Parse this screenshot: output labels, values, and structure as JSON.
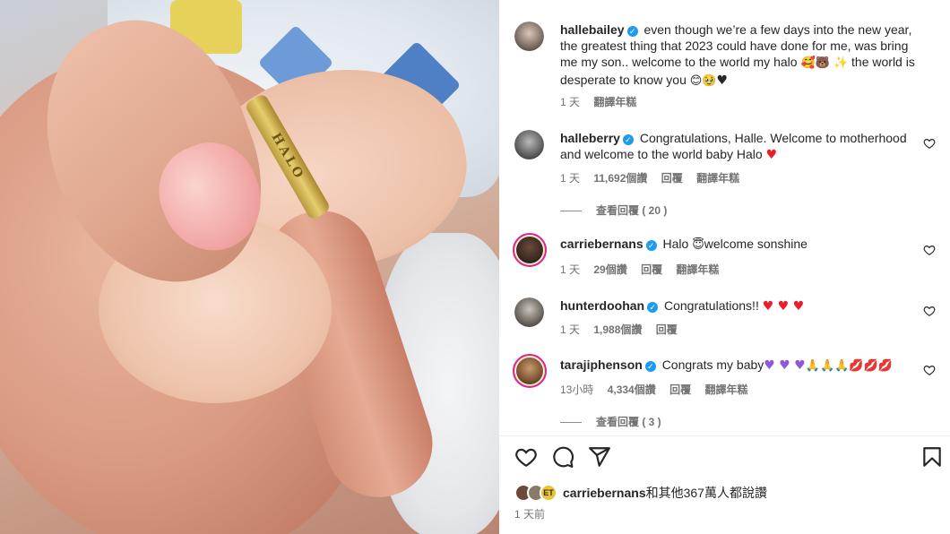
{
  "photo": {
    "bracelet_text": "HALO"
  },
  "caption": {
    "username": "hallebailey",
    "text": "even though we’re a few days into the new year, the greatest thing that 2023 could have done for me, was bring me my son.. welcome to the world my halo",
    "text_end_a": "the world is desperate to know you",
    "time": "1 天",
    "translate": "翻譯年糕"
  },
  "comments": [
    {
      "username": "halleberry",
      "text": "Congratulations, Halle. Welcome to motherhood and welcome to the world baby Halo",
      "time": "1 天",
      "likes": "11,692個讚",
      "reply": "回覆",
      "translate": "翻譯年糕",
      "view_replies": "查看回覆 ( 20 )"
    },
    {
      "username": "carriebernans",
      "text_a": "Halo",
      "text_b": "welcome sonshine",
      "time": "1 天",
      "likes": "29個讚",
      "reply": "回覆",
      "translate": "翻譯年糕"
    },
    {
      "username": "hunterdoohan",
      "text": "Congratulations!!",
      "time": "1 天",
      "likes": "1,988個讚",
      "reply": "回覆"
    },
    {
      "username": "tarajiphenson",
      "text": "Congrats my baby",
      "time": "13小時",
      "likes": "4,334個讚",
      "reply": "回覆",
      "translate": "翻譯年糕",
      "view_replies": "查看回覆 ( 3 )"
    }
  ],
  "likes_bar": {
    "et_badge": "ET",
    "username": "carriebernans",
    "rest": "和其他367萬人都說讚"
  },
  "post_time": "1 天前",
  "icons": [
    "verified-badge",
    "heart-icon",
    "comment-icon",
    "share-icon",
    "bookmark-icon"
  ],
  "colors": {
    "verified": "#1d9bf0",
    "meta_text": "#737373",
    "heart_red": "#ed1c2b",
    "heart_purple": "#8e5bd8"
  }
}
